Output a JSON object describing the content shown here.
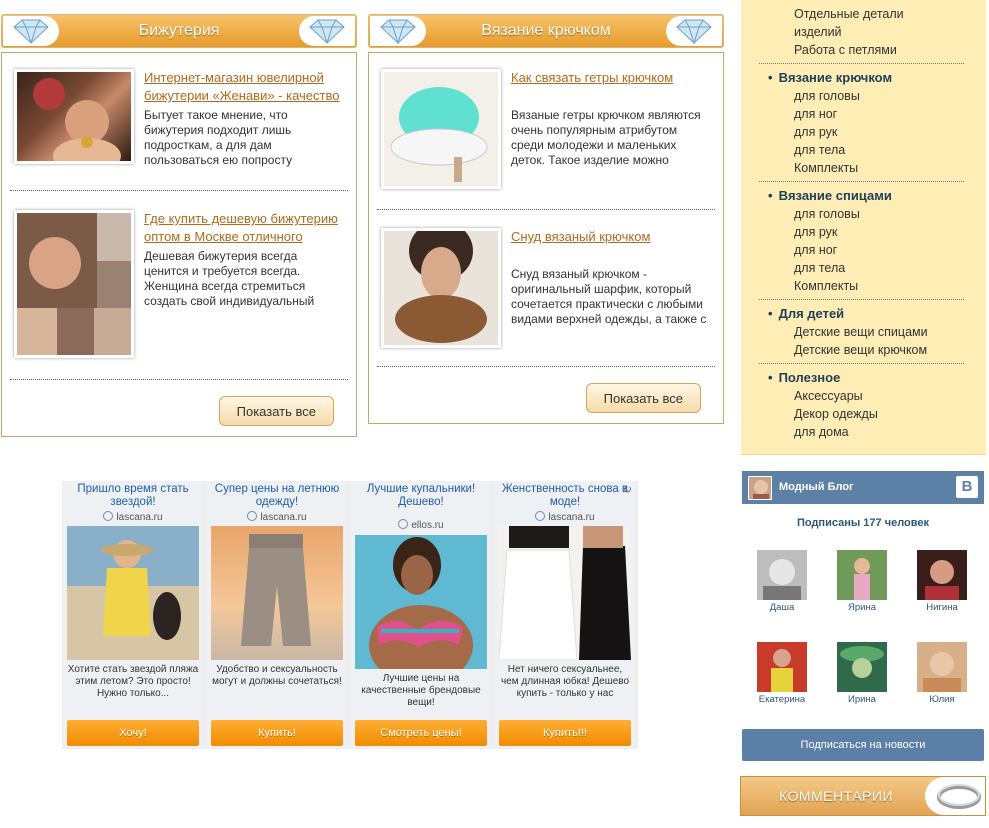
{
  "blocks": [
    {
      "title": "Бижутерия",
      "posts": [
        {
          "title": "Интернет-магазин ювелирной бижутерии «Женави» - качество",
          "text": "Бытует такое мнение, что бижутерия подходит лишь подросткам, а для дам пользоваться ею попросту неуместно. Но это не так"
        },
        {
          "title": "Где купить дешевую бижутерию оптом в Москве отличного",
          "text": "Дешевая бижутерия всегда ценится и требуется всегда. Женщина всегда стремиться создать свой индивидуальный образ"
        }
      ],
      "button": "Показать все"
    },
    {
      "title": "Вязание крючком",
      "posts": [
        {
          "title": "Как связать гетры крючком",
          "text": "Вязаные гетры крючком являются очень популярным атрибутом среди молодежи и маленьких деток. Такое изделие можно связать"
        },
        {
          "title": "Снуд вязаный крючком",
          "text": "Снуд вязаный крючком - оригинальный шарфик, который сочетается практически с любыми видами верхней одежды, а также с платьями"
        }
      ],
      "button": "Показать все"
    }
  ],
  "ads": [
    {
      "title": "Пришло время стать звездой!",
      "source": "lascana.ru",
      "text": "Хотите стать звездой пляжа этим летом? Это просто! Нужно только...",
      "button": "Хочу!"
    },
    {
      "title": "Супер цены на летнюю одежду!",
      "source": "lascana.ru",
      "text": "Удобство и сексуальность могут и должны сочетаться!",
      "button": "Купить!"
    },
    {
      "title": "Лучшие купальники! Дешево!",
      "source": "ellos.ru",
      "text": "Лучшие цены на качественные брендовые вещи!",
      "button": "Смотреть цены!"
    },
    {
      "title": "Женственность снова в моде!",
      "source": "lascana.ru",
      "text": "Нет ничего сексуальнее, чем длинная юбка! Дешево купить - только у нас",
      "button": "Купить!!!"
    }
  ],
  "ad_badge": "AD",
  "menu": {
    "top_items": [
      "Отдельные детали",
      "изделий",
      "Работа с петлями"
    ],
    "sections": [
      {
        "label": "Вязание крючком",
        "items": [
          "для головы",
          "для ног",
          "для рук",
          "для тела",
          "Комплекты"
        ]
      },
      {
        "label": "Вязание спицами",
        "items": [
          "для головы",
          "для рук",
          "для ног",
          "для тела",
          "Комплекты"
        ]
      },
      {
        "label": "Для детей",
        "items": [
          "Детские вещи спицами",
          "Детские вещи крючком"
        ]
      },
      {
        "label": "Полезное",
        "items": [
          "Аксессуары",
          "Декор одежды",
          "для дома"
        ]
      }
    ]
  },
  "vk": {
    "group_name": "Модный Блог",
    "logo": "В",
    "subscribers_text": "Подписаны 177 человек",
    "users": [
      "Даша",
      "Ярина",
      "Нигина",
      "Екатерина",
      "Ирина",
      "Юлия"
    ],
    "subscribe_button": "Подписаться на новости"
  },
  "comments_title": "КОММЕНТАРИИ",
  "colors": {
    "accent": "#e69b2a",
    "link": "#b06a1d",
    "menu_bg": "#feedb5",
    "vk": "#5d81a6",
    "ad_button": "#f29200"
  }
}
